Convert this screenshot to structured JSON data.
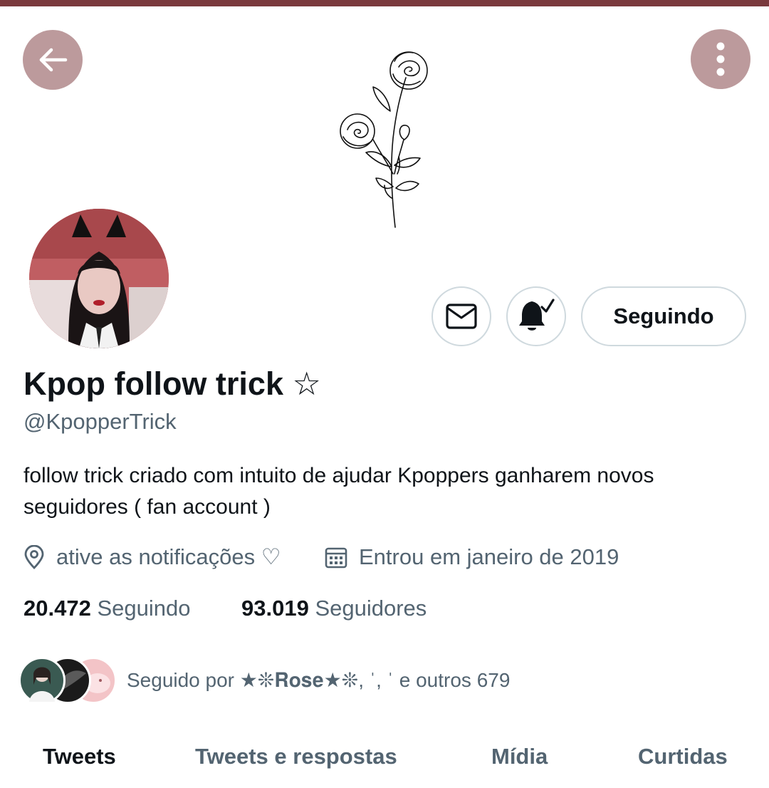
{
  "colors": {
    "top_strip": "#7a3a3d",
    "circle_button": "#bc9a9c",
    "secondary_text": "#536471",
    "primary_text": "#0f1419",
    "button_border": "#cfd9de"
  },
  "header": {
    "back_icon": "arrow-left-icon",
    "more_icon": "more-vertical-icon"
  },
  "banner": {
    "art": "rose-line-drawing"
  },
  "actions": {
    "message_icon": "envelope-icon",
    "notify_icon": "bell-check-icon",
    "follow_label": "Seguindo"
  },
  "profile": {
    "display_name": "Kpop follow trick ☆",
    "handle": "@KpopperTrick",
    "bio": "follow trick criado com intuito de ajudar Kpoppers ganharem novos seguidores  ( fan account )",
    "location": "ative as notificações ♡",
    "joined": "Entrou em janeiro de 2019"
  },
  "stats": {
    "following_count": "20.472",
    "following_label": "Seguindo",
    "followers_count": "93.019",
    "followers_label": "Seguidores"
  },
  "followed_by": {
    "text": "Seguido por ★❊𝐑𝐨𝐬𝐞★❊, ˈ, ˈ e outros 679"
  },
  "tabs": [
    {
      "label": "Tweets",
      "active": true
    },
    {
      "label": "Tweets e respostas",
      "active": false
    },
    {
      "label": "Mídia",
      "active": false
    },
    {
      "label": "Curtidas",
      "active": false
    }
  ]
}
